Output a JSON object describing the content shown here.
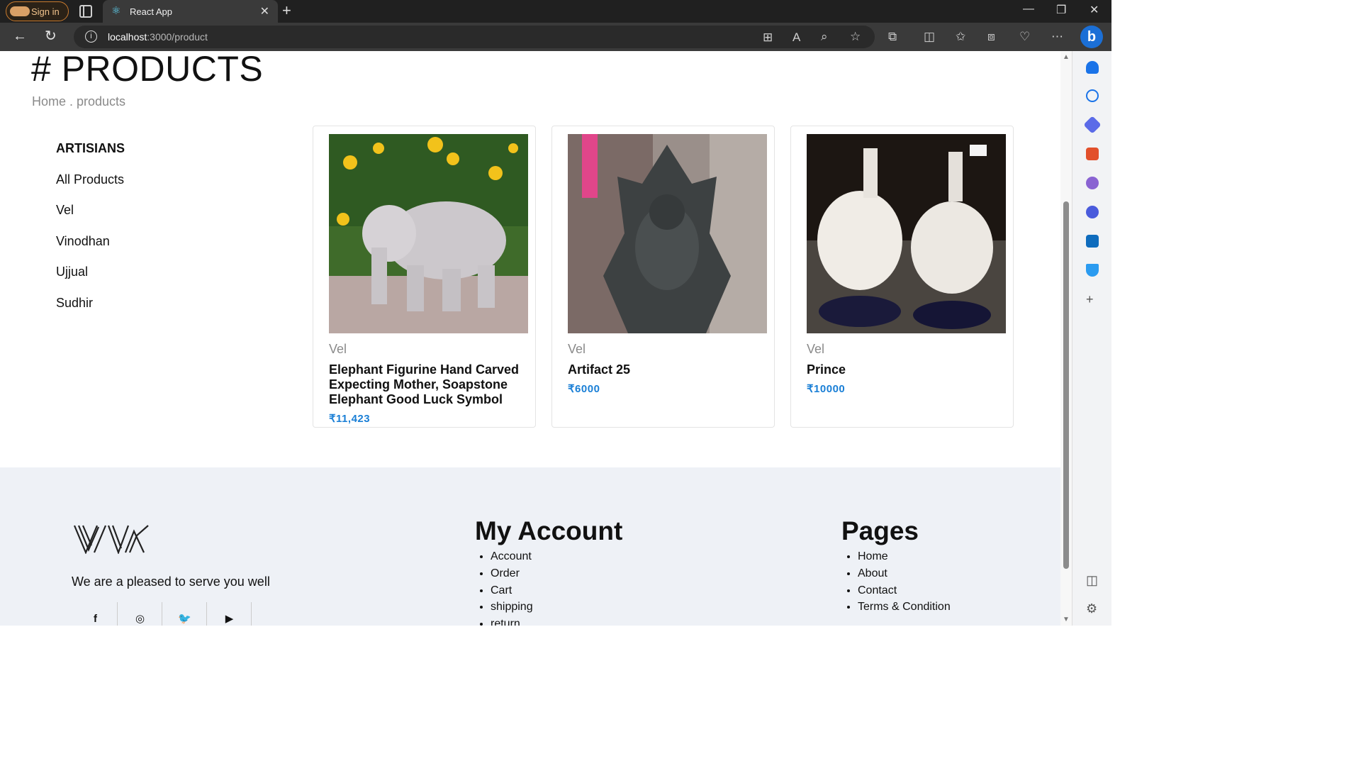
{
  "browser": {
    "signin_label": "Sign in",
    "tab_title": "React App",
    "url_host": "localhost",
    "url_rest": ":3000/product"
  },
  "page": {
    "title": "# PRODUCTS",
    "breadcrumb": "Home . products"
  },
  "sidebar": {
    "title": "ARTISIANS",
    "items": [
      "All Products",
      "Vel",
      "Vinodhan",
      "Ujjual",
      "Sudhir"
    ]
  },
  "products": [
    {
      "artisan": "Vel",
      "name": "Elephant Figurine Hand Carved Expecting Mother, Soapstone Elephant Good Luck Symbol",
      "price": "₹11,423"
    },
    {
      "artisan": "Vel",
      "name": "Artifact 25",
      "price": "₹6000"
    },
    {
      "artisan": "Vel",
      "name": "Prince",
      "price": "₹10000"
    }
  ],
  "footer": {
    "tagline": "We are a pleased to serve you well",
    "account": {
      "title": "My Account",
      "items": [
        "Account",
        "Order",
        "Cart",
        "shipping",
        "return"
      ]
    },
    "pages": {
      "title": "Pages",
      "items": [
        "Home",
        "About",
        "Contact",
        "Terms & Condition"
      ]
    },
    "social_icons": [
      "facebook-icon",
      "instagram-icon",
      "twitter-icon",
      "youtube-icon"
    ]
  },
  "colors": {
    "price": "#1a7fd6",
    "footer_bg": "#eef1f6"
  }
}
